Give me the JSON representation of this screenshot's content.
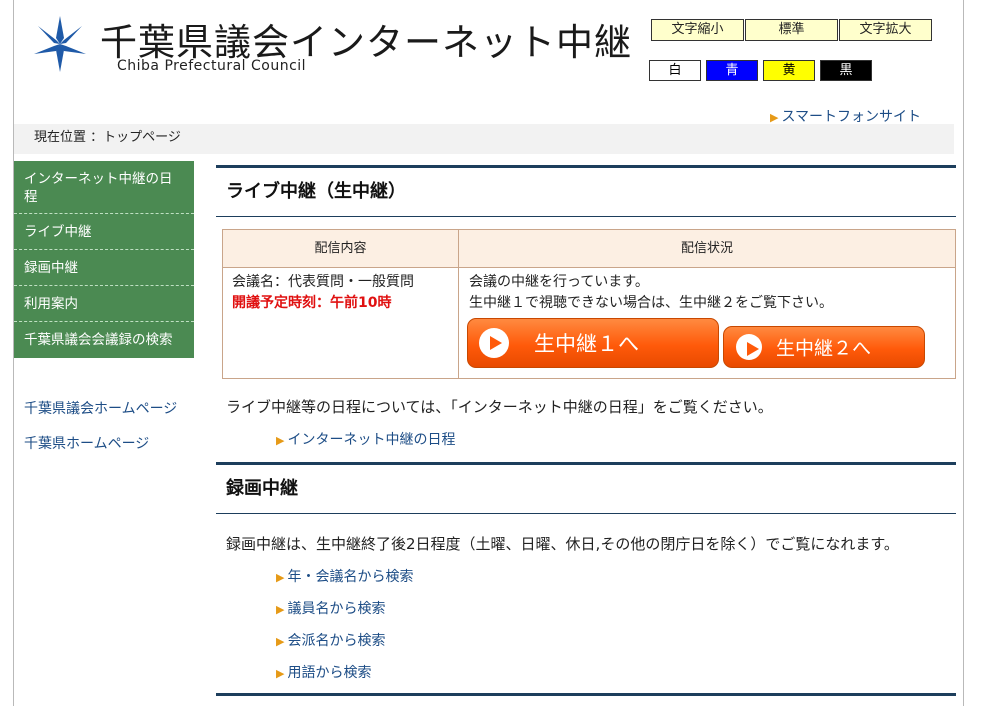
{
  "header": {
    "title": "千葉県議会インターネット中継",
    "subtitle": "Chiba Prefectural Council",
    "font_controls": [
      "文字縮小",
      "標準",
      "文字拡大"
    ],
    "color_controls": [
      {
        "label": "白",
        "bg": "#ffffff",
        "fg": "#000000"
      },
      {
        "label": "青",
        "bg": "#0000ff",
        "fg": "#ffffff"
      },
      {
        "label": "黄",
        "bg": "#ffff00",
        "fg": "#000000"
      },
      {
        "label": "黒",
        "bg": "#000000",
        "fg": "#ffffff"
      }
    ],
    "smartphone_link": "スマートフォンサイト"
  },
  "breadcrumb": "現在位置 ：トップページ",
  "sidebar": {
    "nav": [
      {
        "label": "インターネット中継の日程"
      },
      {
        "label": "ライブ中継"
      },
      {
        "label": "録画中継"
      },
      {
        "label": "利用案内"
      },
      {
        "label": "千葉県議会会議録の検索"
      }
    ],
    "links": [
      "千葉県議会ホームページ",
      "千葉県ホームページ"
    ]
  },
  "live": {
    "title": "ライブ中継（生中継）",
    "table": {
      "col1_header": "配信内容",
      "col2_header": "配信状況",
      "meeting": "会議名：代表質問・一般質問",
      "scheduled_time": "開議予定時刻：午前10時",
      "status_line1": "会議の中継を行っています。",
      "status_line2": "生中継１で視聴できない場合は、生中継２をご覧下さい。",
      "button1": "生中継１へ",
      "button2": "生中継２へ"
    },
    "schedule_note": "ライブ中継等の日程については、「インターネット中継の日程」をご覧ください。",
    "schedule_link": "インターネット中継の日程"
  },
  "recorded": {
    "title": "録画中継",
    "note": "録画中継は、生中継終了後2日程度（土曜、日曜、休日,その他の閉庁日を除く）でご覧になれます。",
    "links": [
      "年・会議名から検索",
      "議員名から検索",
      "会派名から検索",
      "用語から検索"
    ]
  },
  "colors": {
    "accent_green": "#4b8a52",
    "navy_rule": "#1d3e5c",
    "live_orange": "#ff5a0a",
    "link_blue": "#1d4d86"
  }
}
